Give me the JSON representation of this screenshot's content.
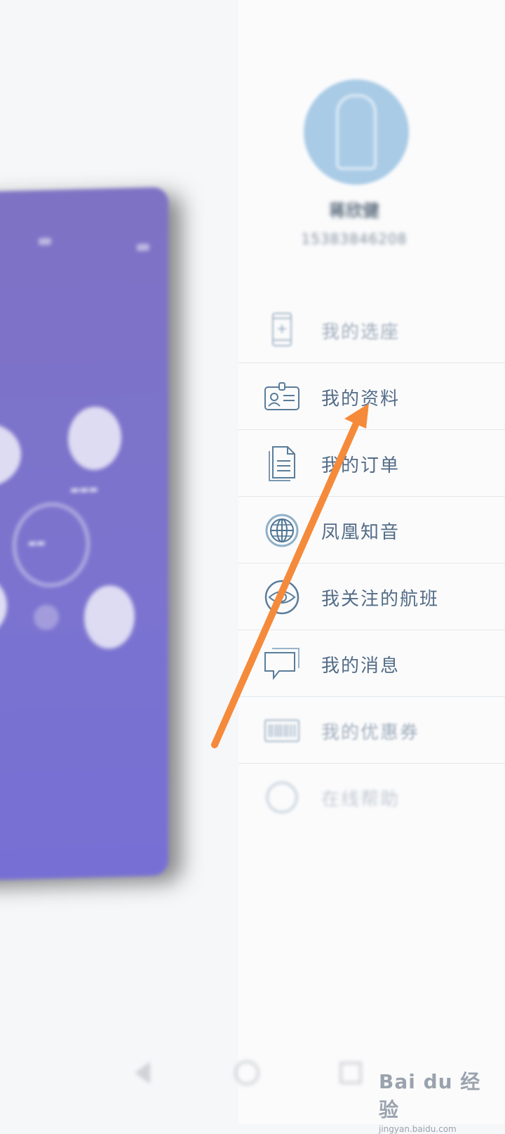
{
  "profile": {
    "name": "蒋欣健",
    "phone": "15383846208"
  },
  "menu": {
    "items": [
      {
        "label": "我的选座",
        "icon": "phone-seat-icon"
      },
      {
        "label": "我的资料",
        "icon": "id-card-icon"
      },
      {
        "label": "我的订单",
        "icon": "document-icon"
      },
      {
        "label": "凤凰知音",
        "icon": "globe-icon"
      },
      {
        "label": "我关注的航班",
        "icon": "eye-icon"
      },
      {
        "label": "我的消息",
        "icon": "message-icon"
      },
      {
        "label": "我的优惠券",
        "icon": "barcode-icon"
      },
      {
        "label": "在线帮助",
        "icon": "help-icon"
      }
    ]
  },
  "colors": {
    "accent_arrow": "#f58a3b",
    "menu_text": "#536c86",
    "app_card": "#7b73cf",
    "avatar": "#a9cbe6"
  },
  "watermark": {
    "main": "Bai du 经验",
    "sub": "jingyan.baidu.com"
  }
}
